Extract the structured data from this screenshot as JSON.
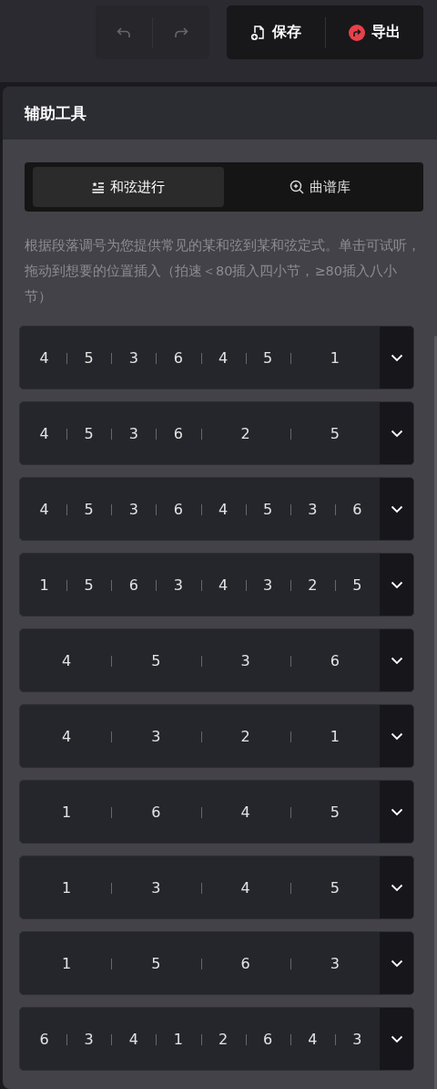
{
  "toolbar": {
    "history": [
      {
        "kind": "undo",
        "disabled": true
      },
      {
        "kind": "redo",
        "disabled": true
      }
    ],
    "actions": [
      {
        "kind": "save",
        "label": "保存"
      },
      {
        "kind": "export",
        "label": "导出"
      }
    ]
  },
  "panel": {
    "title": "辅助工具",
    "tabs": [
      {
        "kind": "progression",
        "label": "和弦进行",
        "selected": true
      },
      {
        "kind": "library",
        "label": "曲谱库",
        "selected": false
      }
    ],
    "description": "根据段落调号为您提供常见的某和弦到某和弦定式。单击可试听，拖动到想要的位置插入（拍速＜80插入四小节，≥80插入八小节）",
    "progressions": [
      {
        "chords": [
          {
            "label": "4",
            "kind": "single"
          },
          {
            "label": "5",
            "kind": "single"
          },
          {
            "label": "3",
            "kind": "single"
          },
          {
            "label": "6",
            "kind": "single"
          },
          {
            "label": "4",
            "kind": "single"
          },
          {
            "label": "5",
            "kind": "single"
          },
          {
            "label": "1",
            "kind": "double"
          }
        ]
      },
      {
        "chords": [
          {
            "label": "4",
            "kind": "single"
          },
          {
            "label": "5",
            "kind": "single"
          },
          {
            "label": "3",
            "kind": "single"
          },
          {
            "label": "6",
            "kind": "single"
          },
          {
            "label": "2",
            "kind": "double"
          },
          {
            "label": "5",
            "kind": "double"
          }
        ]
      },
      {
        "chords": [
          {
            "label": "4",
            "kind": "single"
          },
          {
            "label": "5",
            "kind": "single"
          },
          {
            "label": "3",
            "kind": "single"
          },
          {
            "label": "6",
            "kind": "single"
          },
          {
            "label": "4",
            "kind": "single"
          },
          {
            "label": "5",
            "kind": "single"
          },
          {
            "label": "3",
            "kind": "single"
          },
          {
            "label": "6",
            "kind": "single"
          }
        ]
      },
      {
        "chords": [
          {
            "label": "1",
            "kind": "single"
          },
          {
            "label": "5",
            "kind": "single"
          },
          {
            "label": "6",
            "kind": "single"
          },
          {
            "label": "3",
            "kind": "single"
          },
          {
            "label": "4",
            "kind": "single"
          },
          {
            "label": "3",
            "kind": "single"
          },
          {
            "label": "2",
            "kind": "single"
          },
          {
            "label": "5",
            "kind": "single"
          }
        ]
      },
      {
        "chords": [
          {
            "label": "4",
            "kind": "double"
          },
          {
            "label": "5",
            "kind": "double"
          },
          {
            "label": "3",
            "kind": "double"
          },
          {
            "label": "6",
            "kind": "double"
          }
        ]
      },
      {
        "chords": [
          {
            "label": "4",
            "kind": "double"
          },
          {
            "label": "3",
            "kind": "double"
          },
          {
            "label": "2",
            "kind": "double"
          },
          {
            "label": "1",
            "kind": "double"
          }
        ]
      },
      {
        "chords": [
          {
            "label": "1",
            "kind": "double"
          },
          {
            "label": "6",
            "kind": "double"
          },
          {
            "label": "4",
            "kind": "double"
          },
          {
            "label": "5",
            "kind": "double"
          }
        ]
      },
      {
        "chords": [
          {
            "label": "1",
            "kind": "double"
          },
          {
            "label": "3",
            "kind": "double"
          },
          {
            "label": "4",
            "kind": "double"
          },
          {
            "label": "5",
            "kind": "double"
          }
        ]
      },
      {
        "chords": [
          {
            "label": "1",
            "kind": "double"
          },
          {
            "label": "5",
            "kind": "double"
          },
          {
            "label": "6",
            "kind": "double"
          },
          {
            "label": "3",
            "kind": "double"
          }
        ]
      },
      {
        "chords": [
          {
            "label": "6",
            "kind": "single"
          },
          {
            "label": "3",
            "kind": "single"
          },
          {
            "label": "4",
            "kind": "single"
          },
          {
            "label": "1",
            "kind": "single"
          },
          {
            "label": "2",
            "kind": "single"
          },
          {
            "label": "6",
            "kind": "single"
          },
          {
            "label": "4",
            "kind": "single"
          },
          {
            "label": "3",
            "kind": "single"
          }
        ]
      }
    ]
  }
}
